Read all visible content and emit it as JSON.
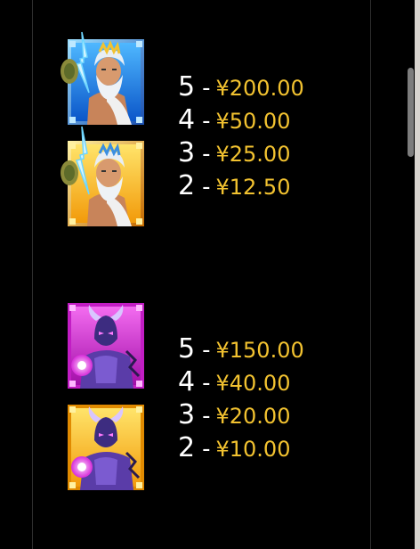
{
  "colors": {
    "background": "#000000",
    "count_text": "#ffffff",
    "payout_text": "#f2c230"
  },
  "symbols": [
    {
      "name": "zeus",
      "icon": "zeus-symbol-icon",
      "tile_variants": [
        "blue-frame",
        "gold-frame"
      ],
      "payouts": [
        {
          "count": "5",
          "dash": "-",
          "value": "¥200.00"
        },
        {
          "count": "4",
          "dash": "-",
          "value": "¥50.00"
        },
        {
          "count": "3",
          "dash": "-",
          "value": "¥25.00"
        },
        {
          "count": "2",
          "dash": "-",
          "value": "¥12.50"
        }
      ]
    },
    {
      "name": "demon-warrior",
      "icon": "horned-warrior-symbol-icon",
      "tile_variants": [
        "magenta-frame",
        "gold-frame"
      ],
      "payouts": [
        {
          "count": "5",
          "dash": "-",
          "value": "¥150.00"
        },
        {
          "count": "4",
          "dash": "-",
          "value": "¥40.00"
        },
        {
          "count": "3",
          "dash": "-",
          "value": "¥20.00"
        },
        {
          "count": "2",
          "dash": "-",
          "value": "¥10.00"
        }
      ]
    }
  ]
}
